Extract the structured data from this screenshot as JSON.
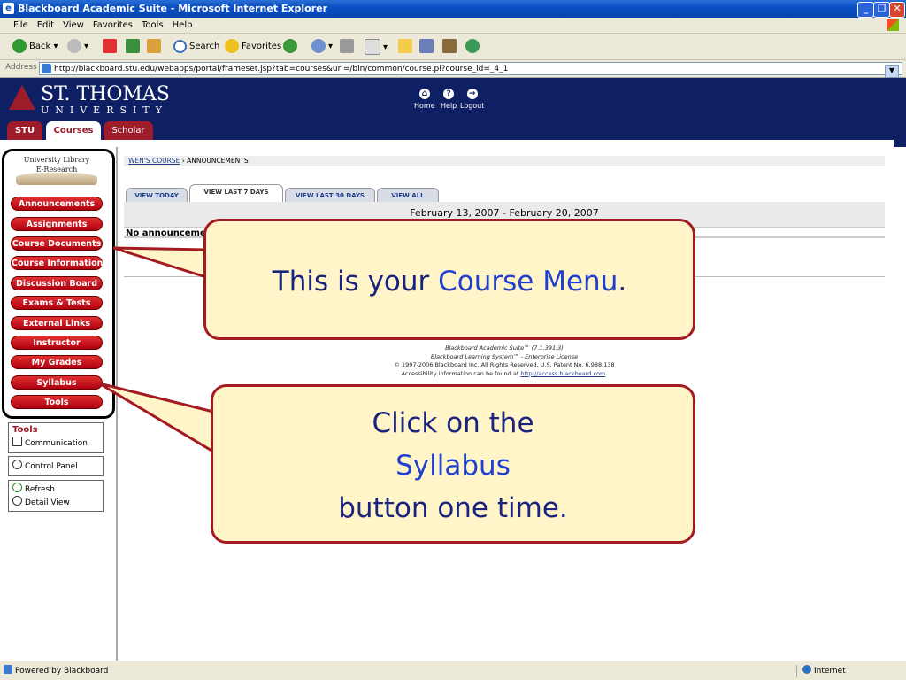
{
  "window": {
    "title": "Blackboard Academic Suite - Microsoft Internet Explorer"
  },
  "menubar": {
    "items": [
      "File",
      "Edit",
      "View",
      "Favorites",
      "Tools",
      "Help"
    ]
  },
  "toolbar": {
    "back": "Back",
    "search": "Search",
    "favorites": "Favorites"
  },
  "address": {
    "label": "Address",
    "url": "http://blackboard.stu.edu/webapps/portal/frameset.jsp?tab=courses&url=/bin/common/course.pl?course_id=_4_1"
  },
  "header": {
    "logo_main": "ST. THOMAS",
    "logo_sub": "UNIVERSITY",
    "nav": [
      "Home",
      "Help",
      "Logout"
    ],
    "tabs": [
      "STU",
      "Courses",
      "Scholar"
    ]
  },
  "sidebar": {
    "library_line1": "University Library",
    "library_line2": "E-Research",
    "course_menu": [
      "Announcements",
      "Assignments",
      "Course Documents",
      "Course Information",
      "Discussion Board",
      "Exams & Tests",
      "External Links",
      "Instructor",
      "My Grades",
      "Syllabus",
      "Tools"
    ],
    "tools_title": "Tools",
    "tools_items": [
      "Communication"
    ],
    "control_panel": "Control Panel",
    "refresh": "Refresh",
    "detail_view": "Detail View"
  },
  "content": {
    "breadcrumb_link": "WEN'S COURSE",
    "breadcrumb_sep": "›",
    "breadcrumb_current": "ANNOUNCEMENTS",
    "view_tabs": [
      "VIEW TODAY",
      "VIEW LAST 7 DAYS",
      "VIEW LAST 30 DAYS",
      "VIEW ALL"
    ],
    "date_range": "February 13, 2007 - February 20, 2007",
    "no_announcements": "No announcemen"
  },
  "footer": {
    "line1": "Blackboard Academic Suite™ (7.1.391.3)",
    "line2": "Blackboard Learning System™ - Enterprise License",
    "line3": "© 1997-2006 Blackboard Inc. All Rights Reserved. U.S. Patent No. 6,988,138",
    "line4_prefix": "Accessibility information can be found at",
    "line4_link": "http://access.blackboard.com",
    "line4_suffix": "."
  },
  "callouts": {
    "c1_text": "This is your",
    "c1_highlight": "Course Menu",
    "c1_end": ".",
    "c2_line1": "Click on the",
    "c2_highlight": "Syllabus",
    "c2_line3": "button one time."
  },
  "status": {
    "left": "Powered by Blackboard",
    "zone": "Internet"
  },
  "colors": {
    "header_navy": "#0f1f63",
    "maroon": "#9e1b2a",
    "callout_fill": "#fff5c8",
    "callout_text": "#1a237e",
    "callout_highlight": "#1f3fd0"
  }
}
